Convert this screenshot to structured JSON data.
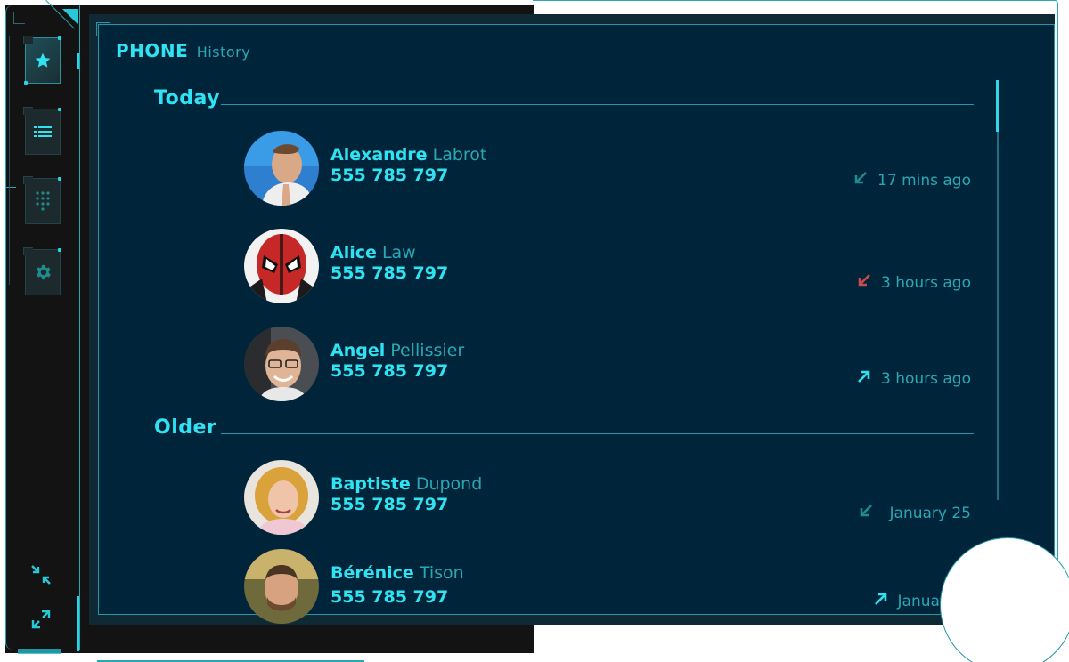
{
  "app": {
    "title": "PHONE",
    "subtitle": "History"
  },
  "nav": [
    {
      "icon": "star-icon",
      "active": true
    },
    {
      "icon": "list-icon",
      "active": false
    },
    {
      "icon": "dialpad-icon",
      "active": false
    },
    {
      "icon": "gear-icon",
      "active": false
    }
  ],
  "tools": [
    {
      "icon": "collapse-icon"
    },
    {
      "icon": "expand-icon"
    }
  ],
  "sections": [
    {
      "title": "Today",
      "entries": [
        {
          "first": "Alexandre",
          "last": "Labrot",
          "phone": "555 785 797",
          "when": "17 mins ago",
          "direction": "incoming",
          "status_color": "#1f8c8c",
          "avatar_bg": "#2f7fd0"
        },
        {
          "first": "Alice",
          "last": "Law",
          "phone": "555 785 797",
          "when": "3 hours ago",
          "direction": "missed",
          "status_color": "#c94b4b",
          "avatar_bg": "#c62828"
        },
        {
          "first": "Angel",
          "last": "Pellissier",
          "phone": "555 785 797",
          "when": "3 hours ago",
          "direction": "outgoing",
          "status_color": "#2fe3f2",
          "avatar_bg": "#6b5a4f"
        }
      ]
    },
    {
      "title": "Older",
      "entries": [
        {
          "first": "Baptiste",
          "last": "Dupond",
          "phone": "555 785 797",
          "when": "January 25",
          "direction": "incoming",
          "status_color": "#1f8c8c",
          "avatar_bg": "#d4a23a"
        },
        {
          "first": "Bérénice",
          "last": "Tison",
          "phone": "555 785 797",
          "when": "January",
          "direction": "outgoing",
          "status_color": "#2fe3f2",
          "avatar_bg": "#8a6a3a"
        }
      ]
    }
  ],
  "colors": {
    "accent": "#2fe3f2",
    "secondary": "#2aa7b4",
    "panel": "#00253a",
    "missed": "#c94b4b"
  }
}
